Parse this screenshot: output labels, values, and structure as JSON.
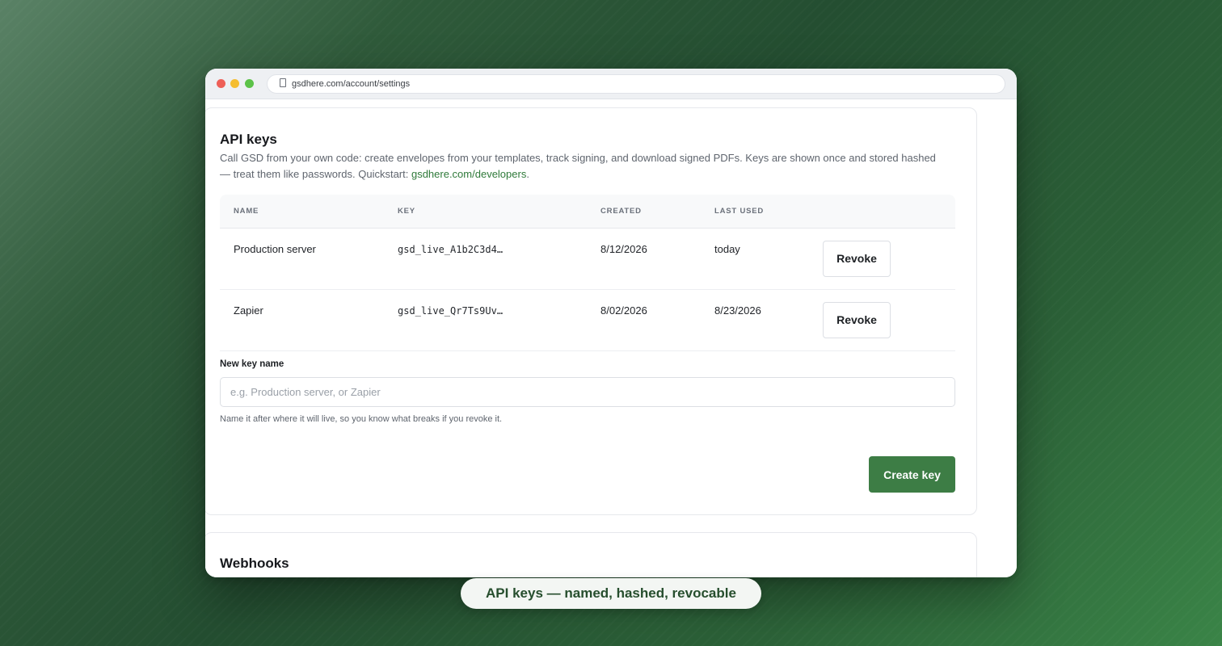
{
  "browser": {
    "url": "gsdhere.com/account/settings"
  },
  "api_keys": {
    "title": "API keys",
    "description": "Call GSD from your own code: create envelopes from your templates, track signing, and download signed PDFs. Keys are shown once and stored hashed — treat them like passwords. Quickstart: ",
    "quickstart_link": "gsdhere.com/developers",
    "description_end": ".",
    "columns": [
      "NAME",
      "KEY",
      "CREATED",
      "LAST USED"
    ],
    "rows": [
      {
        "name": "Production server",
        "key": "gsd_live_A1b2C3d4…",
        "created": "8/12/2026",
        "last_used": "today",
        "action": "Revoke"
      },
      {
        "name": "Zapier",
        "key": "gsd_live_Qr7Ts9Uv…",
        "created": "8/02/2026",
        "last_used": "8/23/2026",
        "action": "Revoke"
      }
    ],
    "new_key_label": "New key name",
    "new_key_value": "",
    "new_key_placeholder": "e.g. Production server, or Zapier",
    "help_text": "Name it after where it will live, so you know what breaks if you revoke it.",
    "create_button": "Create key"
  },
  "webhooks": {
    "title": "Webhooks"
  },
  "caption": "API keys — named, hashed, revocable",
  "colors": {
    "accent": "#3d7d45",
    "link": "#2f7a3a"
  },
  "icons": {
    "address_bar": "lock-icon"
  }
}
